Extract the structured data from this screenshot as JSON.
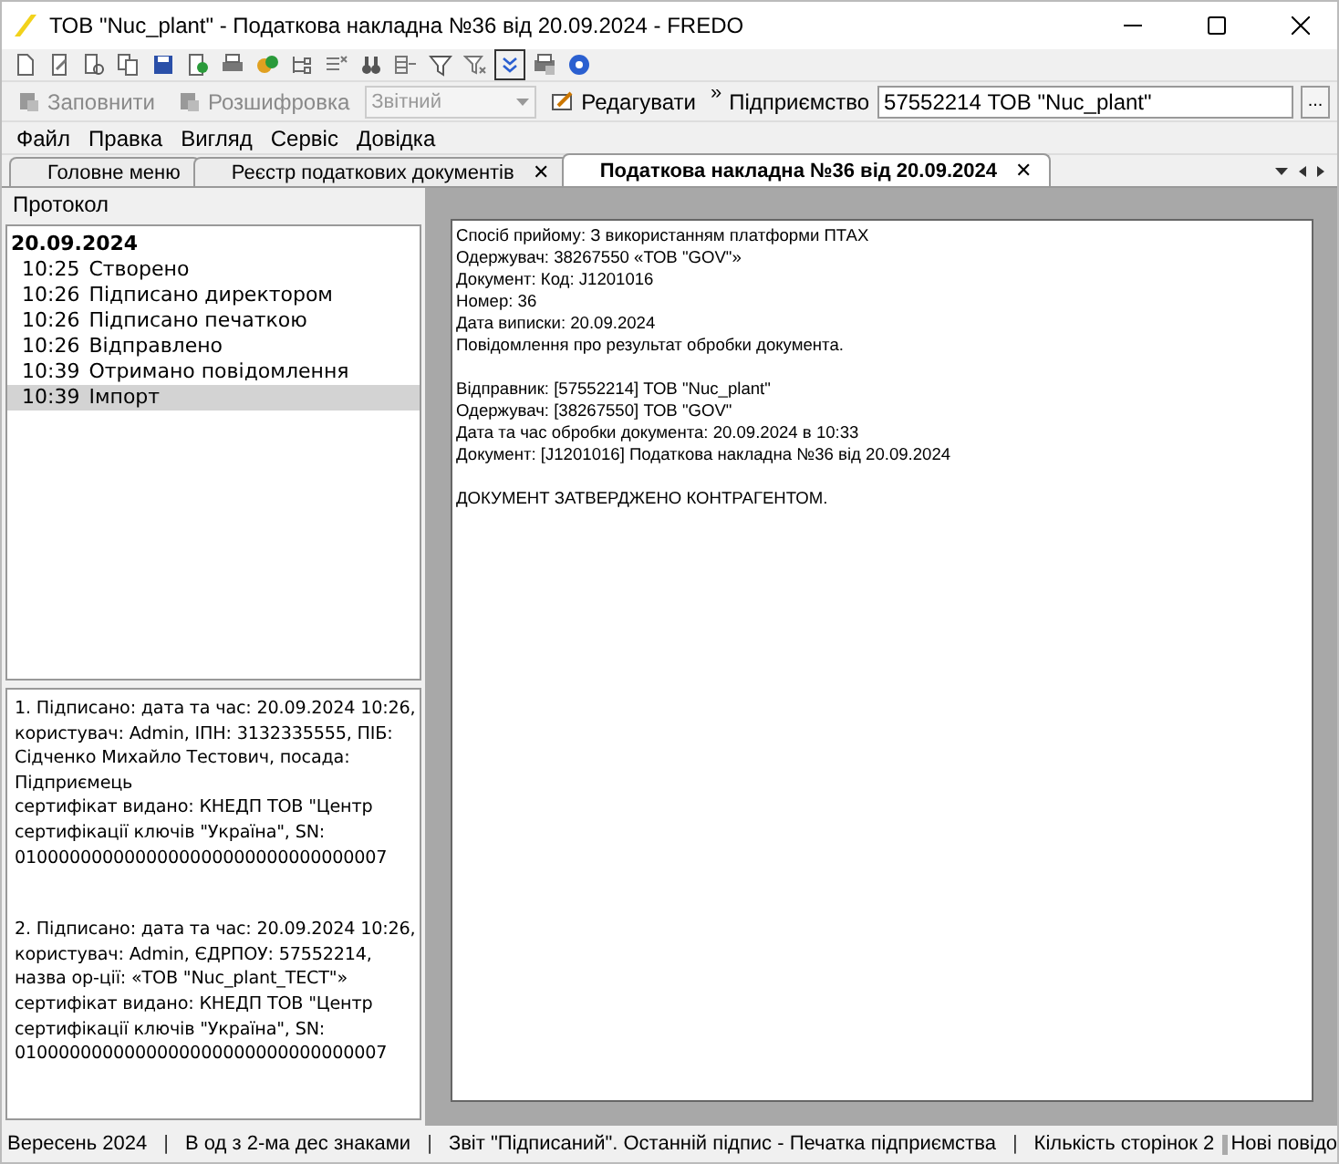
{
  "window": {
    "title": "ТОВ \"Nuc_plant\" - Податкова накладна №36 від 20.09.2024 - FREDO"
  },
  "toolbar2": {
    "buttons": [
      {
        "label": "Заповнити",
        "disabled": true
      },
      {
        "label": "Розшифровка",
        "disabled": true
      }
    ],
    "period_combo": {
      "value": "Звітний",
      "disabled": true
    },
    "edit_button": {
      "label": "Редагувати"
    },
    "more": "»",
    "enterprise_label": "Підприємство",
    "enterprise_value": "57552214  ТОВ \"Nuc_plant\"",
    "browse": "..."
  },
  "menu": [
    "Файл",
    "Правка",
    "Вигляд",
    "Сервіс",
    "Довідка"
  ],
  "tabs": [
    {
      "label": "Головне меню",
      "selected": false
    },
    {
      "label": "Реєстр податкових документів",
      "selected": false,
      "close": "✕"
    },
    {
      "label": "Податкова накладна №36 від 20.09.2024",
      "selected": true,
      "close": "✕"
    }
  ],
  "protocol": {
    "title": "Протокол",
    "date": "20.09.2024",
    "items": [
      {
        "time": "10:25",
        "text": "Створено",
        "selected": false
      },
      {
        "time": "10:26",
        "text": "Підписано директором",
        "selected": false
      },
      {
        "time": "10:26",
        "text": "Підписано печаткою",
        "selected": false
      },
      {
        "time": "10:26",
        "text": "Відправлено",
        "selected": false
      },
      {
        "time": "10:39",
        "text": "Отримано повідомлення",
        "selected": false
      },
      {
        "time": "10:39",
        "text": "Імпорт",
        "selected": true
      }
    ]
  },
  "signatures": [
    "1. Підписано: дата та час: 20.09.2024 10:26, користувач: Admin, ІПН: 3132335555, ПІБ: Сідченко Михайло Тестович, посада: Підприємець\nсертифікат видано: КНЕДП ТОВ \"Центр сертифікації ключів \"Україна\", SN: 0100000000000000000000000000000007",
    "2. Підписано: дата та час: 20.09.2024 10:26, користувач: Admin, ЄДРПОУ: 57552214, назва ор-ції: «ТОВ \"Nuc_plant_ТЕСТ\"»\nсертифікат видано: КНЕДП ТОВ \"Центр сертифікації ключів \"Україна\", SN: 0100000000000000000000000000000007"
  ],
  "document": {
    "paragraphs": [
      [
        "Спосіб прийому: З використанням платформи ПТАХ",
        "Одержувач: 38267550 «ТОВ \"GOV\"»",
        "Документ: Код: J1201016",
        "Номер: 36",
        "Дата виписки: 20.09.2024",
        "Повідомлення про результат обробки документа."
      ],
      [
        "Відправник: [57552214] ТОВ \"Nuc_plant\"",
        "Одержувач:  [38267550] ТОВ \"GOV\"",
        "Дата та час обробки документа: 20.09.2024 в 10:33",
        "Документ: [J1201016] Податкова накладна №36 від 20.09.2024"
      ],
      [
        "ДОКУМЕНТ ЗАТВЕРДЖЕНО КОНТРАГЕНТОМ."
      ]
    ]
  },
  "status_bar": [
    "Вересень 2024",
    "В од з 2-ма дес знаками",
    "Звіт \"Підписаний\". Останній підпис - Печатка підприємства",
    "Кількість сторінок 2"
  ],
  "status_separators": [
    "|",
    "|",
    "|"
  ],
  "status_notice": "Нові повідо"
}
